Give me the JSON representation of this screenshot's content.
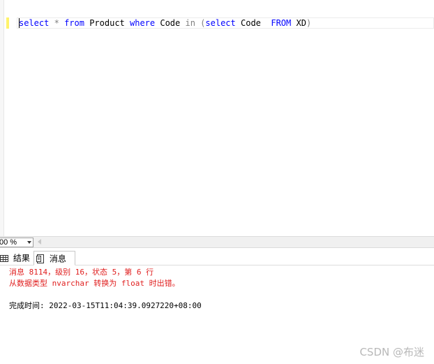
{
  "editor": {
    "query_tokens": [
      {
        "text": "select",
        "kind": "keyword"
      },
      {
        "text": " ",
        "kind": "plain"
      },
      {
        "text": "*",
        "kind": "operator"
      },
      {
        "text": " ",
        "kind": "plain"
      },
      {
        "text": "from",
        "kind": "keyword"
      },
      {
        "text": " Product ",
        "kind": "plain"
      },
      {
        "text": "where",
        "kind": "keyword"
      },
      {
        "text": " Code ",
        "kind": "plain"
      },
      {
        "text": "in",
        "kind": "operator"
      },
      {
        "text": " ",
        "kind": "plain"
      },
      {
        "text": "(",
        "kind": "operator"
      },
      {
        "text": "select",
        "kind": "keyword"
      },
      {
        "text": " Code  ",
        "kind": "plain"
      },
      {
        "text": "FROM",
        "kind": "keyword"
      },
      {
        "text": " XD",
        "kind": "plain"
      },
      {
        "text": ")",
        "kind": "operator"
      }
    ]
  },
  "zoom": {
    "value": "00 %"
  },
  "tabs": {
    "results_label": "结果",
    "messages_label": "消息"
  },
  "messages": {
    "line1": "消息 8114，级别 16，状态 5，第 6 行",
    "line2": "从数据类型 nvarchar 转换为 float 时出错。",
    "completion": "完成时间: 2022-03-15T11:04:39.0927220+08:00"
  },
  "watermark": "CSDN @布迷",
  "colors": {
    "keyword": "#0000ff",
    "operator": "#808080",
    "error_text": "#e02020"
  }
}
